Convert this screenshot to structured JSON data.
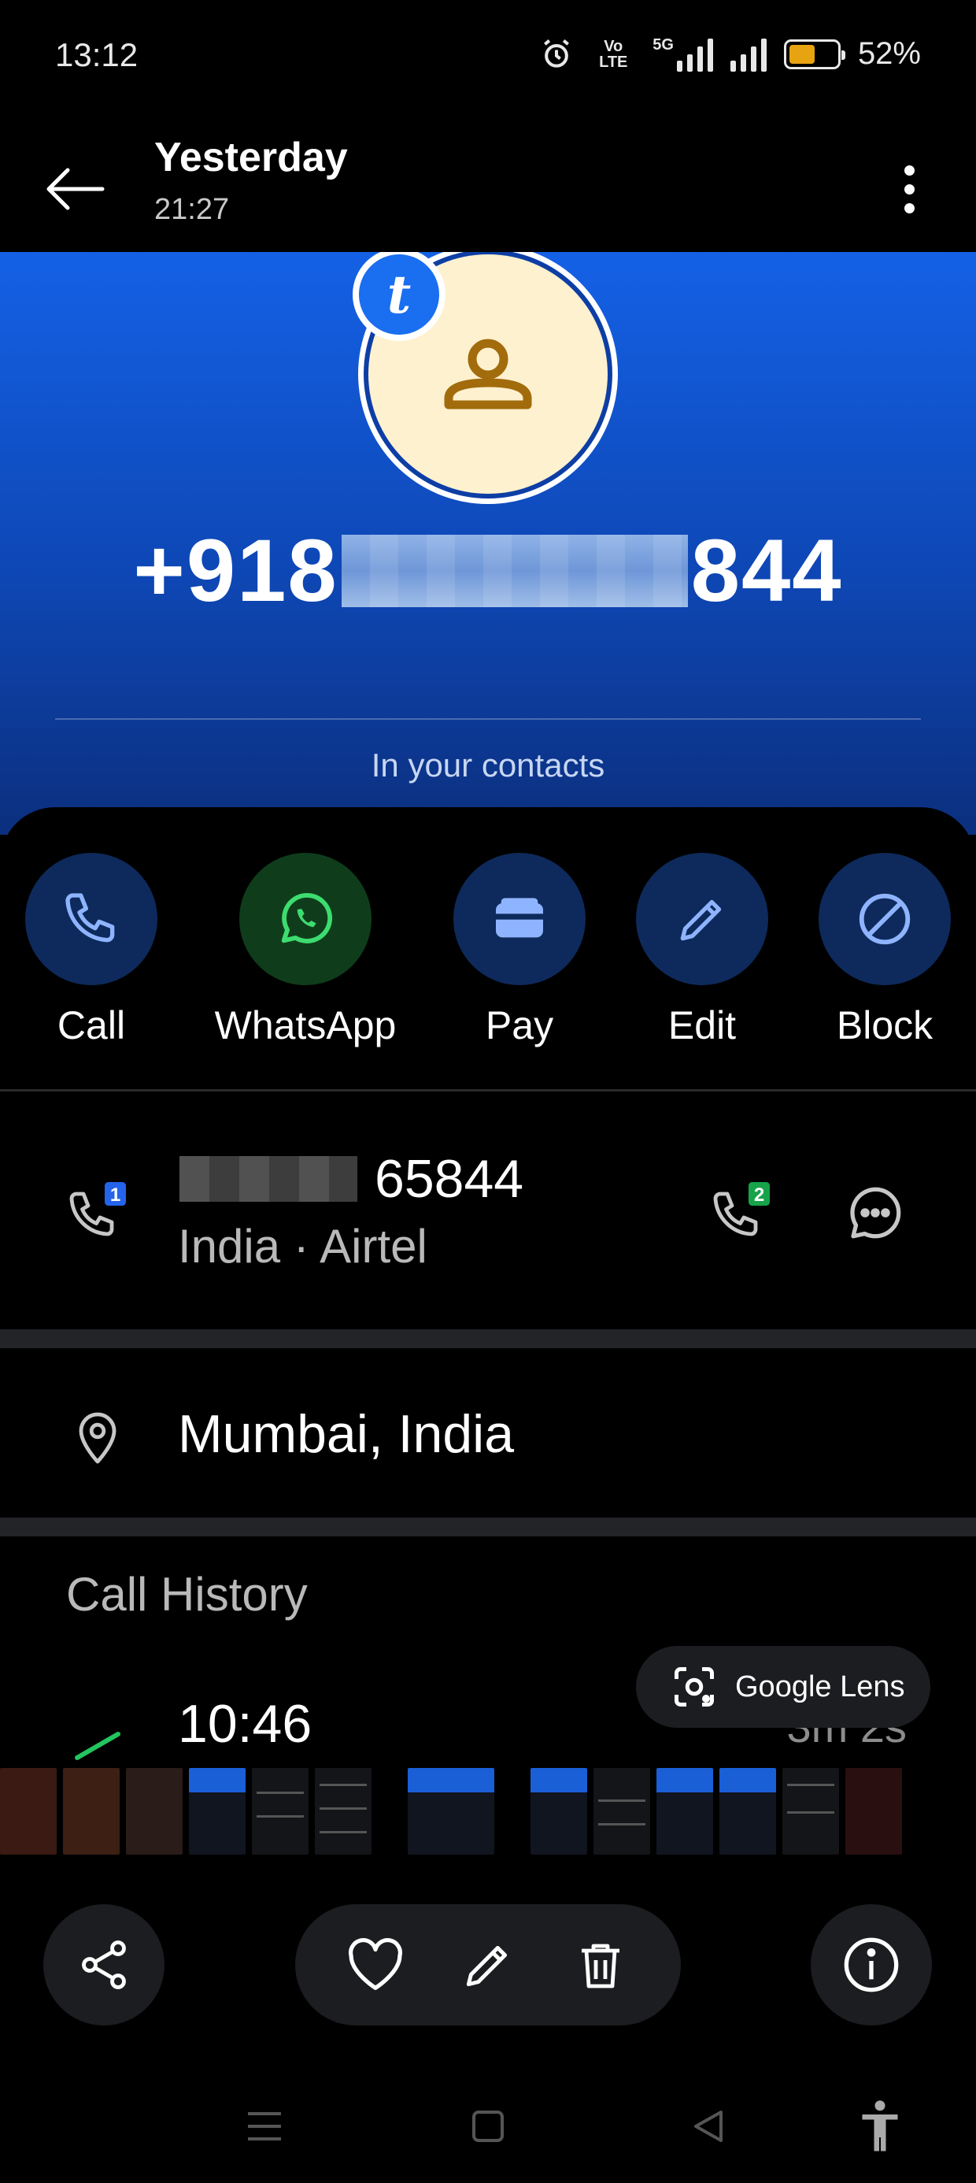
{
  "status_bar": {
    "time": "13:12",
    "volte_label": "Vo LTE",
    "network_label": "5G",
    "battery_percent": "52%",
    "battery_level": 0.52
  },
  "header": {
    "title": "Yesterday",
    "subtitle": "21:27"
  },
  "hero": {
    "badge_letter": "t",
    "phone_prefix": "+918",
    "phone_suffix": "844",
    "contacts_note": "In your contacts",
    "background_color": "#1461e6"
  },
  "actions": [
    {
      "label": "Call",
      "icon": "phone-icon"
    },
    {
      "label": "WhatsApp",
      "icon": "whatsapp-icon"
    },
    {
      "label": "Pay",
      "icon": "wallet-icon"
    },
    {
      "label": "Edit",
      "icon": "pencil-icon"
    },
    {
      "label": "Block",
      "icon": "block-icon"
    }
  ],
  "number_row": {
    "sim1_badge": "1",
    "sim2_badge": "2",
    "number_visible": "65844",
    "carrier": "India · Airtel"
  },
  "location": {
    "text": "Mumbai, India"
  },
  "call_history": {
    "title": "Call History",
    "time": "10:46",
    "duration": "3m 2s"
  },
  "lens_chip": {
    "label": "Google Lens"
  },
  "toolbar": {
    "share": "share-icon",
    "favorite": "heart-icon",
    "edit": "pencil-icon",
    "delete": "trash-icon",
    "info": "info-icon"
  },
  "colors": {
    "accent_blue": "#1a6ef0",
    "battery": "#e8a311",
    "whatsapp_green": "#25d366"
  }
}
